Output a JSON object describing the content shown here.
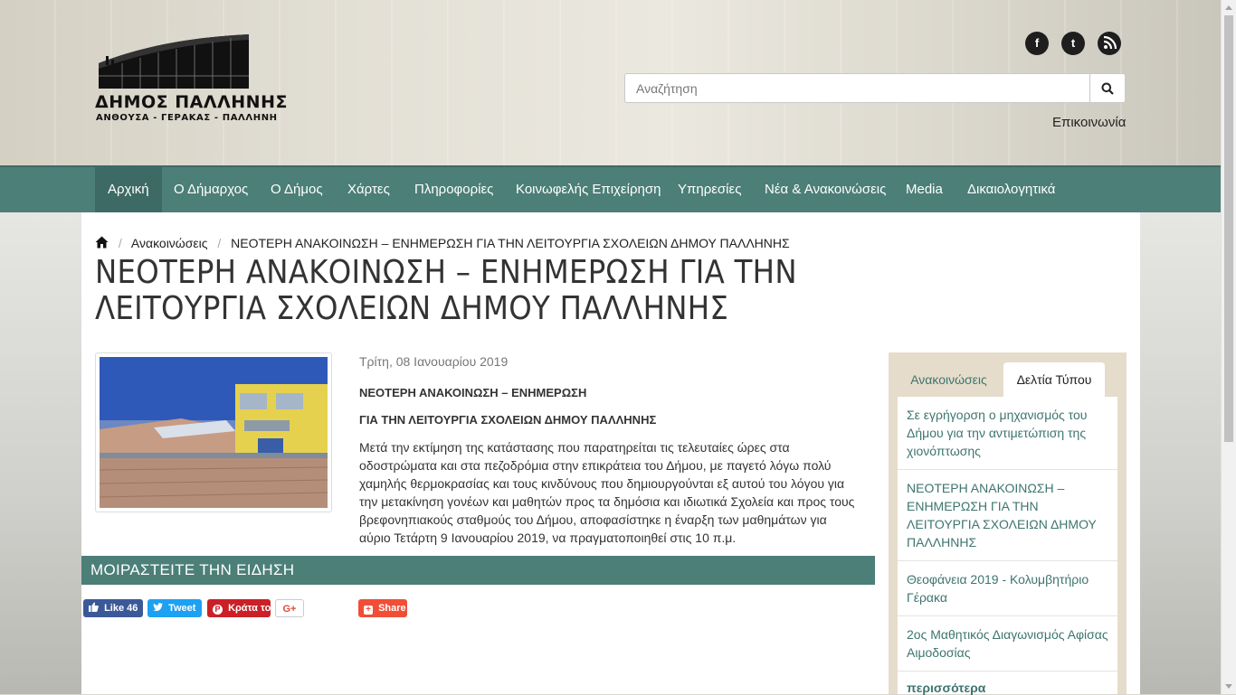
{
  "header": {
    "logo_title": "ΔΗΜΟΣ ΠΑΛΛΗΝΗΣ",
    "logo_subtitle": "ΑΝΘΟΥΣΑ - ΓΕΡΑΚΑΣ - ΠΑΛΛΗΝΗ",
    "social": [
      {
        "icon": "facebook-icon",
        "glyph": "f"
      },
      {
        "icon": "twitter-icon",
        "glyph": "t"
      },
      {
        "icon": "rss-icon",
        "glyph": ""
      }
    ],
    "search_placeholder": "Αναζήτηση",
    "contact_label": "Επικοινωνία"
  },
  "nav": {
    "items": [
      {
        "label": "Αρχική"
      },
      {
        "label": "Ο Δήμαρχος"
      },
      {
        "label": "Ο Δήμος"
      },
      {
        "label": "Χάρτες"
      },
      {
        "label": "Πληροφορίες"
      },
      {
        "label": "Κοινωφελής Επιχείρηση"
      },
      {
        "label": "Υπηρεσίες"
      },
      {
        "label": "Νέα & Ανακοινώσεις"
      },
      {
        "label": "Media"
      },
      {
        "label": "Δικαιολογητικά"
      }
    ],
    "active_index": 0
  },
  "breadcrumb": {
    "section": "Ανακοινώσεις",
    "current": "ΝΕΟΤΕΡΗ ΑΝΑΚΟΙΝΩΣΗ – ΕΝΗΜΕΡΩΣΗ ΓΙΑ ΤΗΝ ΛΕΙΤΟΥΡΓΙΑ ΣΧΟΛΕΙΩΝ ΔΗΜΟΥ ΠΑΛΛΗΝΗΣ"
  },
  "article": {
    "title": "ΝΕΟΤΕΡΗ ΑΝΑΚΟΙΝΩΣΗ – ΕΝΗΜΕΡΩΣΗ ΓΙΑ ΤΗΝ ΛΕΙΤΟΥΡΓΙΑ ΣΧΟΛΕΙΩΝ ΔΗΜΟΥ ΠΑΛΛΗΝΗΣ",
    "date": "Τρίτη, 08 Ιανουαρίου 2019",
    "heading1": "ΝΕΟΤΕΡΗ ΑΝΑΚΟΙΝΩΣΗ – ΕΝΗΜΕΡΩΣΗ",
    "heading2": "ΓΙΑ ΤΗΝ ΛΕΙΤΟΥΡΓΙΑ ΣΧΟΛΕΙΩΝ ΔΗΜΟΥ ΠΑΛΛΗΝΗΣ",
    "body": "Μετά την εκτίμηση της κατάστασης που παρατηρείται τις τελευταίες ώρες στα οδοστρώματα και στα πεζοδρόμια στην επικράτεια του Δήμου, με παγετό λόγω πολύ χαμηλής θερμοκρασίας και τους κινδύνους που δημιουργούνται εξ αυτού του λόγου για την μετακίνηση γονέων και μαθητών προς τα δημόσια και ιδιωτικά Σχολεία και προς τους βρεφονηπιακούς σταθμούς του Δήμου, αποφασίστηκε η έναρξη των μαθημάτων για αύριο Τετάρτη 9 Ιανουαρίου 2019, να πραγματοποιηθεί στις 10 π.μ."
  },
  "share": {
    "heading": "ΜΟΙΡΑΣΤΕΙΤΕ ΤΗΝ ΕΙΔΗΣΗ",
    "like_label": "Like 46",
    "tweet_label": "Tweet",
    "pin_label": "Κράτα το",
    "gplus_label": "G+",
    "share_label": "Share"
  },
  "sidebar": {
    "tabs": [
      "Ανακοινώσεις",
      "Δελτία Τύπου"
    ],
    "active_tab": 1,
    "items": [
      "Σε εγρήγορση ο μηχανισμός του Δήμου για την αντιμετώπιση της χιονόπτωσης",
      "ΝΕΟΤΕΡΗ ΑΝΑΚΟΙΝΩΣΗ – ΕΝΗΜΕΡΩΣΗ ΓΙΑ ΤΗΝ ΛΕΙΤΟΥΡΓΙΑ ΣΧΟΛΕΙΩΝ ΔΗΜΟΥ ΠΑΛΛΗΝΗΣ",
      "Θεοφάνεια 2019 - Κολυμβητήριο Γέρακα",
      "2ος Μαθητικός Διαγωνισμός Αφίσας Αιμοδοσίας"
    ],
    "more_label": "περισσότερα"
  },
  "colors": {
    "nav_bg": "#4b7f78",
    "nav_active": "#3d6a64",
    "link": "#3e756e",
    "sidebar_bg": "#e6dccb",
    "facebook": "#3b5998",
    "twitter": "#1da1f2",
    "pinterest": "#cb2027",
    "share_orange": "#f04e37"
  }
}
